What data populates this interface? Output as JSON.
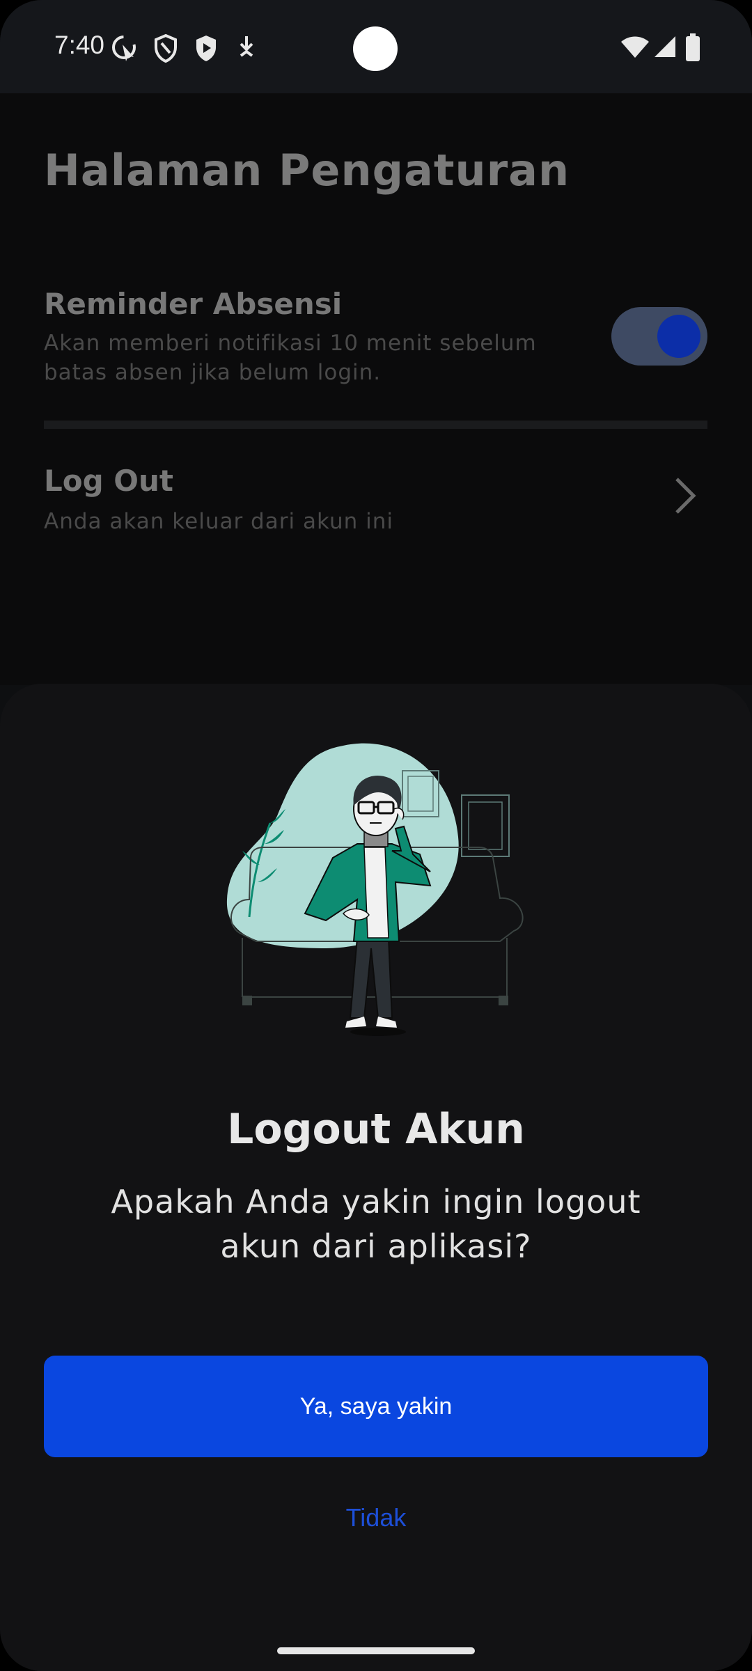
{
  "status_bar": {
    "time": "7:40",
    "left_icons": [
      "screen-record-icon",
      "shield-icon",
      "play-protect-icon",
      "download-icon"
    ],
    "right_icons": [
      "wifi-icon",
      "signal-icon",
      "battery-icon"
    ]
  },
  "settings": {
    "title": "Halaman Pengaturan",
    "reminder": {
      "title": "Reminder Absensi",
      "subtitle": "Akan memberi notifikasi 10 menit sebelum batas absen jika belum login.",
      "enabled": true
    },
    "logout": {
      "title": "Log Out",
      "subtitle": "Anda akan keluar dari akun ini"
    }
  },
  "dialog": {
    "title": "Logout Akun",
    "message": "Apakah Anda yakin ingin logout akun dari aplikasi?",
    "confirm_label": "Ya, saya yakin",
    "cancel_label": "Tidak"
  },
  "colors": {
    "accent": "#0a47e0",
    "link": "#1d4fd8",
    "illustration_bg": "#b0dcd6",
    "jacket": "#0d8c72"
  }
}
